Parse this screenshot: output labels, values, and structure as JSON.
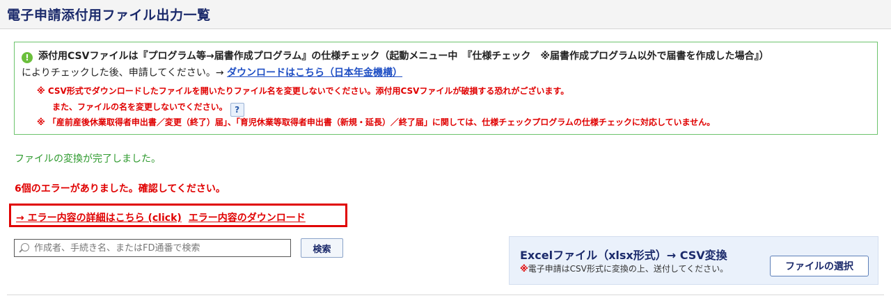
{
  "header": {
    "title": "電子申請添付用ファイル出力一覧"
  },
  "notice": {
    "line1": "添付用CSVファイルは『プログラム等→届書作成プログラム』の仕様チェック（起動メニュー中　『仕様チェック　※届書作成プログラム以外で届書を作成した場合』）",
    "line2_prefix": "によりチェックした後、申請してください。→ ",
    "download_link": "ダウンロードはこちら（日本年金機構）",
    "warning1": "※ CSV形式でダウンロードしたファイルを開いたりファイル名を変更しないでください。添付用CSVファイルが破損する恐れがございます。",
    "warning2": "また、ファイルの名を変更しないでください。",
    "help_label": "?",
    "warning3": "※ 「産前産後休業取得者申出書／変更（終了）届」、「育児休業等取得者申出書（新規・延長）／終了届」に関しては、仕様チェックプログラムの仕様チェックに対応していません。",
    "icon": "info-icon",
    "icon_glyph": "!"
  },
  "status": {
    "success": "ファイルの変換が完了しました。",
    "error_count_msg": "6個のエラーがありました。確認してください。",
    "error_detail_link": "→ エラー内容の詳細はこちら (click)",
    "error_download_link": "エラー内容のダウンロード"
  },
  "search": {
    "placeholder": "作成者、手続き名、またはFD通番で検索",
    "value": "",
    "button_label": "検索"
  },
  "convert": {
    "title": "Excelファイル（xlsx形式）→ CSV変換",
    "note_mark": "※",
    "note": "電子申請はCSV形式に変換の上、送付してください。",
    "button_label": "ファイルの選択"
  },
  "colors": {
    "title": "#1b2a6b",
    "error": "#e00000",
    "success": "#2e9a2e",
    "link": "#1f4fc4",
    "notice_border": "#6cc36c",
    "panel_bg": "#eaf1fb"
  }
}
